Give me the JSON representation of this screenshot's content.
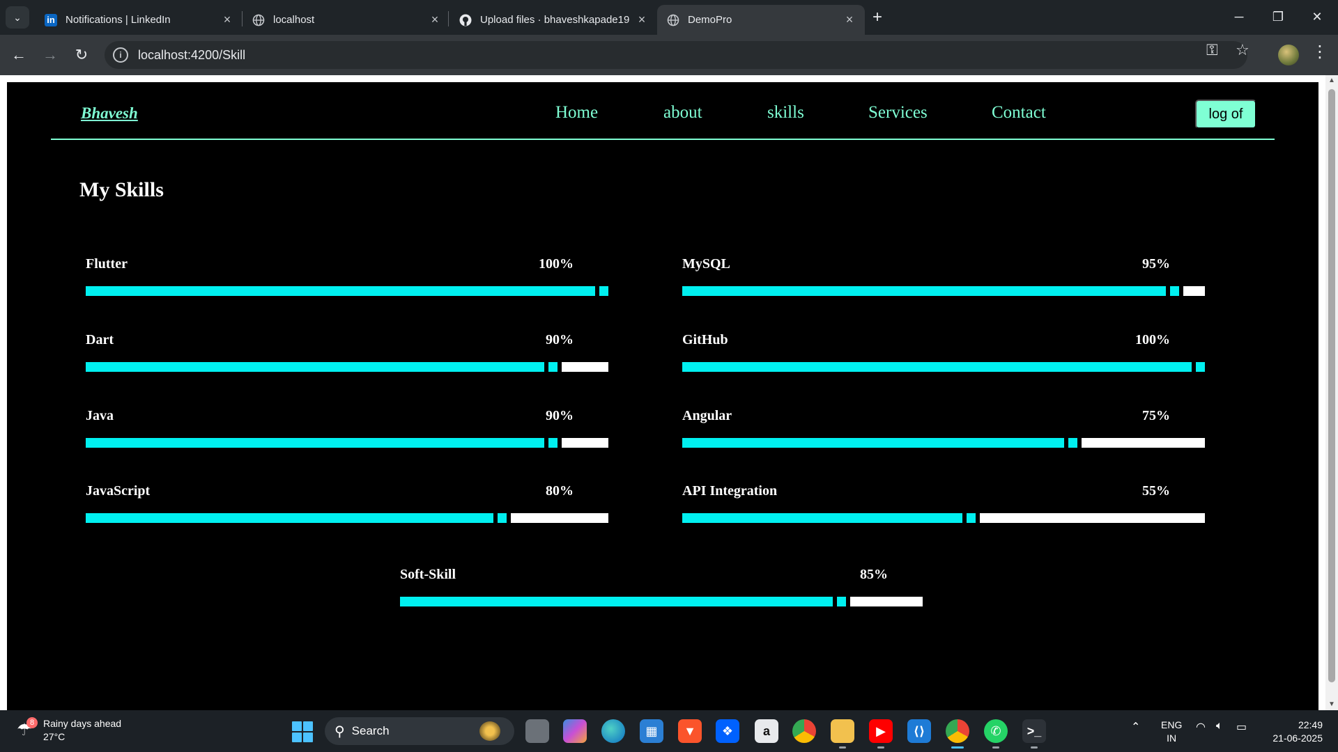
{
  "browser": {
    "tabs": [
      {
        "title": "Notifications | LinkedIn",
        "favicon": "linkedin-icon"
      },
      {
        "title": "localhost",
        "favicon": "globe-icon"
      },
      {
        "title": "Upload files · bhaveshkapade19",
        "favicon": "github-icon"
      },
      {
        "title": "DemoPro",
        "favicon": "globe-icon",
        "active": true
      }
    ],
    "url": "localhost:4200/Skill"
  },
  "site": {
    "brand": "Bhavesh",
    "nav": [
      "Home",
      "about",
      "skills",
      "Services",
      "Contact"
    ],
    "logout_label": "log of",
    "accent_color": "#7fffd4",
    "bar_color": "#00f0f0"
  },
  "skills_section": {
    "heading": "My Skills",
    "skills": [
      {
        "name": "Flutter",
        "percent": 100,
        "label": "100%"
      },
      {
        "name": "MySQL",
        "percent": 95,
        "label": "95%"
      },
      {
        "name": "Dart",
        "percent": 90,
        "label": "90%"
      },
      {
        "name": "GitHub",
        "percent": 100,
        "label": "100%"
      },
      {
        "name": "Java",
        "percent": 90,
        "label": "90%"
      },
      {
        "name": "Angular",
        "percent": 75,
        "label": "75%"
      },
      {
        "name": "JavaScript",
        "percent": 80,
        "label": "80%"
      },
      {
        "name": "API Integration",
        "percent": 55,
        "label": "55%"
      },
      {
        "name": "Soft-Skill",
        "percent": 85,
        "label": "85%"
      }
    ]
  },
  "taskbar": {
    "weather_title": "Rainy days ahead",
    "weather_temp": "27°C",
    "weather_badge": "8",
    "search_label": "Search",
    "lang_line1": "ENG",
    "lang_line2": "IN",
    "time": "22:49",
    "date": "21-06-2025"
  }
}
